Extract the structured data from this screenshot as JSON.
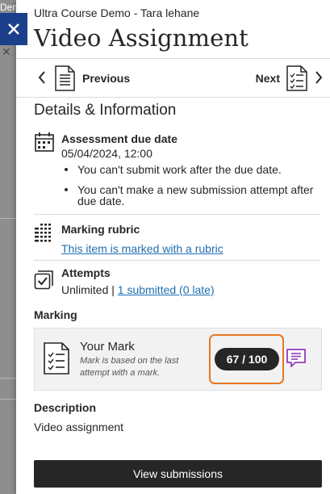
{
  "backdrop": {
    "partial_text": "Dem"
  },
  "panel": {
    "course_name": "Ultra Course Demo - Tara lehane",
    "title": "Video Assignment"
  },
  "nav": {
    "previous_label": "Previous",
    "next_label": "Next"
  },
  "details": {
    "heading": "Details & Information",
    "due": {
      "title": "Assessment due date",
      "date": "05/04/2024, 12:00",
      "bullets": [
        "You can't submit work after the due date.",
        "You can't make a new submission attempt after due date."
      ]
    },
    "rubric": {
      "title": "Marking rubric",
      "link": "This item is marked with a rubric"
    },
    "attempts": {
      "title": "Attempts",
      "value": "Unlimited",
      "separator": "|",
      "link": "1 submitted (0 late)"
    }
  },
  "marking": {
    "heading": "Marking",
    "your_mark": "Your Mark",
    "note": "Mark is based on the last attempt with a mark.",
    "grade": "67 / 100"
  },
  "description": {
    "heading": "Description",
    "text": "Video assignment"
  },
  "actions": {
    "view_submissions": "View submissions"
  },
  "colors": {
    "close_button": "#1c3f8c",
    "grade_highlight": "#e87722",
    "feedback_icon": "#8e3cc3",
    "link": "#1f6fb1"
  }
}
